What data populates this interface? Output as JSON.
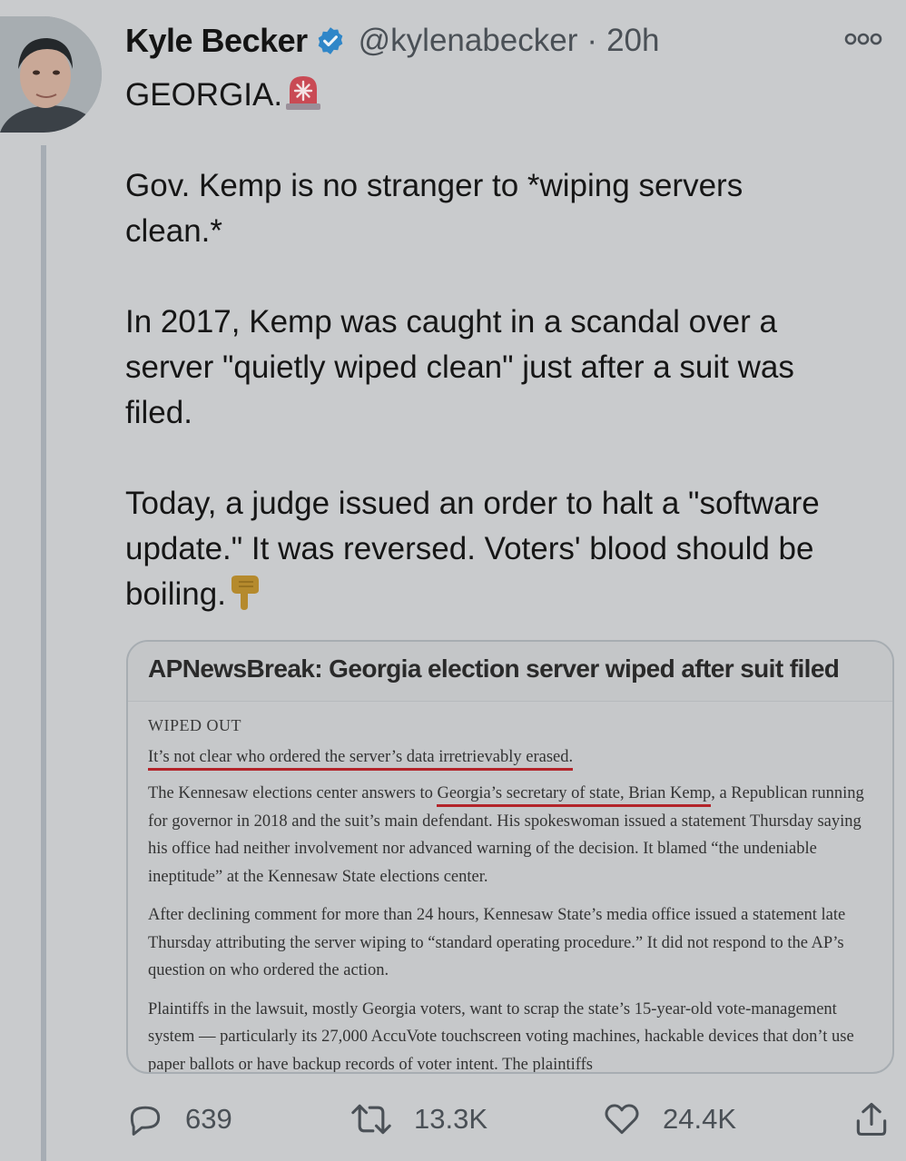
{
  "tweet": {
    "author_name": "Kyle Becker",
    "handle": "@kylenabecker",
    "separator": "·",
    "time": "20h",
    "lines": {
      "l1": "GEORGIA.",
      "l2": "Gov. Kemp is no stranger to *wiping servers",
      "l3": "clean.*",
      "l4": "In 2017, Kemp was caught in a scandal over a",
      "l5": "server \"quietly wiped clean\" just after a suit was",
      "l6": "filed.",
      "l7": "Today, a judge issued an order to halt a \"software",
      "l8": "update.\" It was reversed. Voters' blood should be",
      "l9": "boiling."
    }
  },
  "card": {
    "headline": "APNewsBreak: Georgia election server wiped after suit filed",
    "kicker": "WIPED OUT",
    "subhead": "It’s not clear who ordered the server’s data irretrievably erased.",
    "p1_before": "The Kennesaw elections center answers to ",
    "p1_underlined": "Georgia’s secretary of state, Brian Kemp",
    "p1_after": ", a Republican running for governor in 2018 and the suit’s main defendant. His spokeswoman issued a statement Thursday saying his office had neither involvement nor advanced warning of the decision. It blamed “the undeniable ineptitude” at the Kennesaw State elections center.",
    "p2": "After declining comment for more than 24 hours, Kennesaw State’s media office issued a statement late Thursday attributing the server wiping to “standard operating procedure.” It did not respond to the AP’s question on who ordered the action.",
    "p3": "Plaintiffs in the lawsuit, mostly Georgia voters, want to scrap the state’s 15-year-old vote-management system — particularly its 27,000 AccuVote touchscreen voting machines, hackable devices that don’t use paper ballots or have backup records of voter intent. The plaintiffs"
  },
  "actions": {
    "replies": "639",
    "retweets": "13.3K",
    "likes": "24.4K"
  },
  "icons": {
    "verified": "verified-badge-icon",
    "more": "more-options-icon",
    "siren": "rotating-light-emoji",
    "pointing": "backhand-index-pointing-down-emoji",
    "reply": "reply-icon",
    "retweet": "retweet-icon",
    "like": "heart-icon",
    "share": "share-icon"
  },
  "colors": {
    "background": "#c9cbcd",
    "verified": "#2f86c8",
    "underline": "#b3242a"
  }
}
